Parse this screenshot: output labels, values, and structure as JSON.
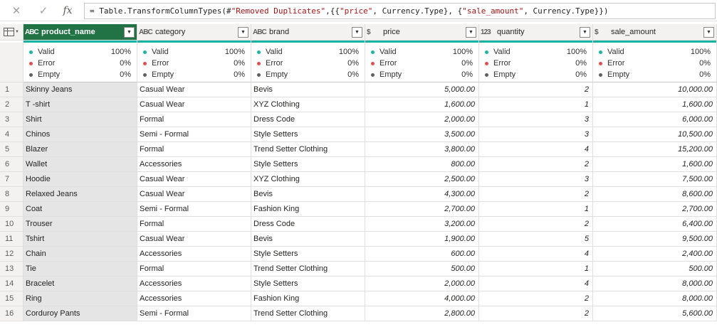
{
  "formula_bar": {
    "cancel_icon": "close-icon",
    "confirm_icon": "check-icon",
    "fx_label": "fx",
    "formula": {
      "prefix": "= Table.TransformColumnTypes(#",
      "step_name": "\"Removed Duplicates\"",
      "mid1": ",{{",
      "col1": "\"price\"",
      "mid2": ", Currency.Type}, {",
      "col2": "\"sale_amount\"",
      "suffix": ", Currency.Type}})"
    }
  },
  "columns": [
    {
      "name": "product_name",
      "type_icon": "ABC",
      "align": "left"
    },
    {
      "name": "category",
      "type_icon": "ABC",
      "align": "left"
    },
    {
      "name": "brand",
      "type_icon": "ABC",
      "align": "left"
    },
    {
      "name": "price",
      "type_icon": "$",
      "align": "right"
    },
    {
      "name": "quantity",
      "type_icon": "123",
      "align": "right"
    },
    {
      "name": "sale_amount",
      "type_icon": "$",
      "align": "right"
    }
  ],
  "quality": {
    "labels": {
      "valid": "Valid",
      "error": "Error",
      "empty": "Empty"
    },
    "values": [
      {
        "valid": "100%",
        "error": "0%",
        "empty": "0%"
      },
      {
        "valid": "100%",
        "error": "0%",
        "empty": "0%"
      },
      {
        "valid": "100%",
        "error": "0%",
        "empty": "0%"
      },
      {
        "valid": "100%",
        "error": "0%",
        "empty": "0%"
      },
      {
        "valid": "100%",
        "error": "0%",
        "empty": "0%"
      },
      {
        "valid": "100%",
        "error": "0%",
        "empty": "0%"
      }
    ]
  },
  "rows": [
    [
      "1",
      "Skinny Jeans",
      "Casual Wear",
      "Bevis",
      "5,000.00",
      "2",
      "10,000.00"
    ],
    [
      "2",
      "T -shirt",
      "Casual Wear",
      "XYZ Clothing",
      "1,600.00",
      "1",
      "1,600.00"
    ],
    [
      "3",
      "Shirt",
      "Formal",
      "Dress Code",
      "2,000.00",
      "3",
      "6,000.00"
    ],
    [
      "4",
      "Chinos",
      "Semi - Formal",
      "Style Setters",
      "3,500.00",
      "3",
      "10,500.00"
    ],
    [
      "5",
      "Blazer",
      "Formal",
      "Trend Setter Clothing",
      "3,800.00",
      "4",
      "15,200.00"
    ],
    [
      "6",
      "Wallet",
      "Accessories",
      "Style Setters",
      "800.00",
      "2",
      "1,600.00"
    ],
    [
      "7",
      "Hoodie",
      "Casual Wear",
      "XYZ Clothing",
      "2,500.00",
      "3",
      "7,500.00"
    ],
    [
      "8",
      "Relaxed Jeans",
      "Casual Wear",
      "Bevis",
      "4,300.00",
      "2",
      "8,600.00"
    ],
    [
      "9",
      "Coat",
      "Semi - Formal",
      "Fashion King",
      "2,700.00",
      "1",
      "2,700.00"
    ],
    [
      "10",
      "Trouser",
      "Formal",
      "Dress Code",
      "3,200.00",
      "2",
      "6,400.00"
    ],
    [
      "11",
      "Tshirt",
      "Casual Wear",
      "Bevis",
      "1,900.00",
      "5",
      "9,500.00"
    ],
    [
      "12",
      "Chain",
      "Accessories",
      "Style Setters",
      "600.00",
      "4",
      "2,400.00"
    ],
    [
      "13",
      "Tie",
      "Formal",
      "Trend Setter Clothing",
      "500.00",
      "1",
      "500.00"
    ],
    [
      "14",
      "Bracelet",
      "Accessories",
      "Style Setters",
      "2,000.00",
      "4",
      "8,000.00"
    ],
    [
      "15",
      "Ring",
      "Accessories",
      "Fashion King",
      "4,000.00",
      "2",
      "8,000.00"
    ],
    [
      "16",
      "Corduroy Pants",
      "Semi - Formal",
      "Trend Setter Clothing",
      "2,800.00",
      "2",
      "5,600.00"
    ]
  ],
  "colors": {
    "selected_header": "#217346",
    "quality_bar": "#17b3a3",
    "error_dot": "#e04e4e"
  }
}
